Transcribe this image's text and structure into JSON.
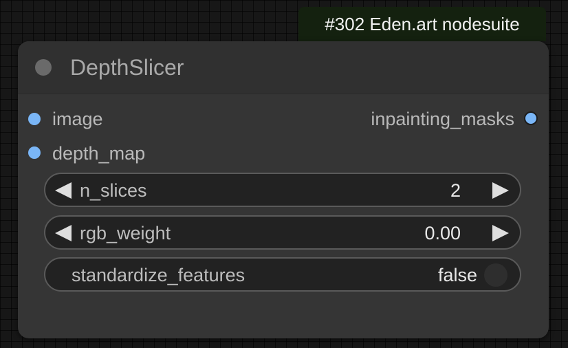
{
  "badge": {
    "text": "#302 Eden.art nodesuite"
  },
  "node": {
    "title": "DepthSlicer",
    "inputs": [
      {
        "label": "image"
      },
      {
        "label": "depth_map"
      }
    ],
    "outputs": [
      {
        "label": "inpainting_masks"
      }
    ],
    "widgets": {
      "n_slices": {
        "label": "n_slices",
        "value": "2"
      },
      "rgb_weight": {
        "label": "rgb_weight",
        "value": "0.00"
      },
      "standardize_features": {
        "label": "standardize_features",
        "value": "false"
      }
    }
  },
  "colors": {
    "input_slot": "#7ab6f7",
    "output_slot": "#7ab6f7",
    "badge_bg": "#14210f",
    "node_bg": "#353535"
  },
  "icons": {
    "status": "circle-status-icon",
    "decrement": "triangle-left-icon",
    "increment": "triangle-right-icon",
    "toggle": "toggle-off-icon"
  }
}
